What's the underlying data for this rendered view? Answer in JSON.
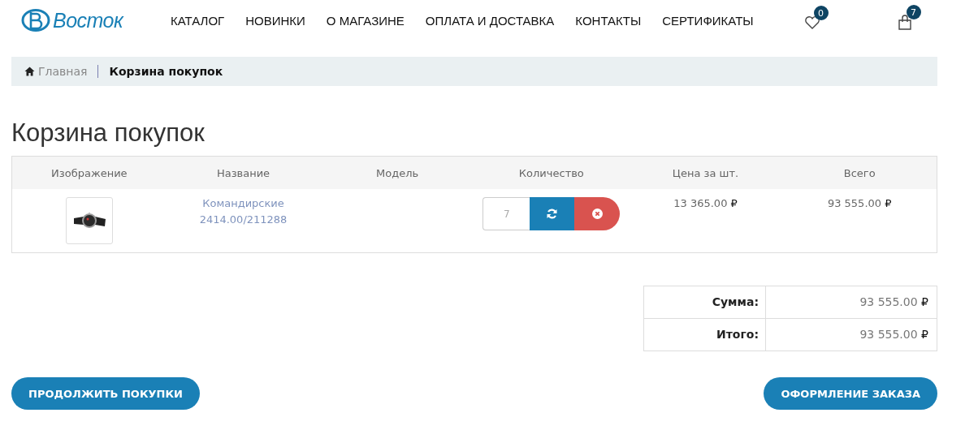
{
  "header": {
    "logo": "Восток",
    "menu": [
      "КАТАЛОГ",
      "НОВИНКИ",
      "О МАГАЗИНЕ",
      "ОПЛАТА И ДОСТАВКА",
      "КОНТАКТЫ",
      "СЕРТИФИКАТЫ"
    ],
    "wishlist_count": "0",
    "cart_count": "7"
  },
  "breadcrumb": [
    {
      "label": "Главная",
      "current": false
    },
    {
      "label": "Корзина покупок",
      "current": true
    }
  ],
  "title": "Корзина покупок",
  "cart": {
    "columns": [
      "Изображение",
      "Название",
      "Модель",
      "Количество",
      "Цена за шт.",
      "Всего"
    ],
    "rows": [
      {
        "name": [
          "Командирские",
          "2414.00/211288"
        ],
        "quantity": "7",
        "price": "13 365.00",
        "total": "93 555.00",
        "currency": "₽"
      }
    ]
  },
  "totals": [
    {
      "label": "Сумма:",
      "amount": "93 555.00",
      "currency": "₽"
    },
    {
      "label": "Итого:",
      "amount": "93 555.00",
      "currency": "₽"
    }
  ],
  "buttons": {
    "continue": "ПРОДОЛЖИТЬ ПОКУПКИ",
    "checkout": "ОФОРМЛЕНИЕ ЗАКАЗА"
  }
}
